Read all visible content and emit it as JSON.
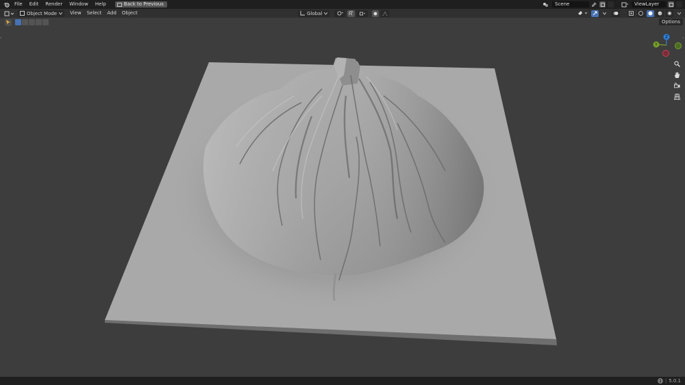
{
  "topbar": {
    "menus": [
      "File",
      "Edit",
      "Render",
      "Window",
      "Help"
    ],
    "back_label": "Back to Previous",
    "scene_label": "Scene",
    "view_layer_label": "ViewLayer"
  },
  "header": {
    "mode_label": "Object Mode",
    "menus": [
      "View",
      "Select",
      "Add",
      "Object"
    ],
    "transform_orientation": "Global"
  },
  "toolbar": {
    "options_label": "Options"
  },
  "gizmo": {
    "z_label": "Z",
    "y_label": "Y",
    "colors": {
      "x": "#c94255",
      "y": "#77a12a",
      "z": "#2c7fd9"
    }
  },
  "statusbar": {
    "version": "5.0.1"
  },
  "icons": [
    "blender-logo-icon",
    "editor-type-icon",
    "cube-icon",
    "pin-icon",
    "scene-browse-icon",
    "new-scene-icon",
    "viewlayer-icon",
    "zoom-icon",
    "hand-icon",
    "camera-icon",
    "grid-icon",
    "globe-icon"
  ]
}
